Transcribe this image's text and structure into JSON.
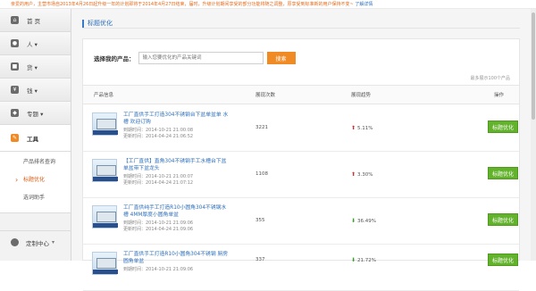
{
  "notice": {
    "text": "亲爱的用户，主营市场自2013年4月26日起升级一年的计划即将于2014年4月27日结束，届时，升级计划期间享受的部分功能将随之调整，原享受到标准新的用户保持不变~",
    "link": "了解详情"
  },
  "sidebar": {
    "items": [
      {
        "label": "首 页",
        "icon": "home-icon",
        "glyph": "⌂"
      },
      {
        "label": "人 ▾",
        "icon": "user-icon",
        "glyph": "●"
      },
      {
        "label": "货 ▾",
        "icon": "goods-icon",
        "glyph": "■"
      },
      {
        "label": "钱 ▾",
        "icon": "money-icon",
        "glyph": "¥"
      },
      {
        "label": "专题 ▾",
        "icon": "topic-icon",
        "glyph": "◆"
      }
    ],
    "active": {
      "label": "工具",
      "icon": "wrench-icon",
      "glyph": "✎"
    },
    "sub_items": [
      "产品排名查询",
      "标题优化",
      "选词助手"
    ],
    "bottom": {
      "label": "定制中心",
      "arrow": "▾",
      "icon": "gear-icon"
    }
  },
  "panel": {
    "title": "标题优化"
  },
  "search": {
    "label": "选择我的产品：",
    "placeholder": "输入您要优化的产品关键词",
    "button": "搜索"
  },
  "limit_text": "最多展示100个产品",
  "table": {
    "headers": [
      "产品信息",
      "展现次数",
      "展现趋势",
      "操作"
    ],
    "rows": [
      {
        "title": "工厂直供手工打造304不锈钢台下盆单盆单 水槽 欢迎订购",
        "time1": "到期时间：2014-10-21 21:00:08",
        "time2": "更新时间：2014-04-24 21:06:52",
        "views": "3221",
        "direction": "up",
        "trend": "5.11%",
        "action": "标题优化"
      },
      {
        "title": "【工厂直供】直角304不锈钢手工水槽台下盆单盆带下盆龙头",
        "time1": "到期时间：2014-10-21 21:00:07",
        "time2": "更新时间：2014-04-24 21:07:12",
        "views": "1108",
        "direction": "up",
        "trend": "3.30%",
        "action": "标题优化"
      },
      {
        "title": "工厂直供纯手工打造R10小圆角304不锈钢水槽 4MM厚度小圆角单盆",
        "time1": "到期时间：2014-10-21 21:09:06",
        "time2": "更新时间：2014-04-24 21:09:06",
        "views": "355",
        "direction": "down",
        "trend": "36.49%",
        "action": "标题优化"
      },
      {
        "title": "工厂直供手工打造R10小圆角304不锈钢 厨房 圆角单盆",
        "time1": "到期时间：2014-10-21 21:09:06",
        "time2": "",
        "views": "337",
        "direction": "down",
        "trend": "21.72%",
        "action": "标题优化"
      }
    ]
  },
  "colors": {
    "accent": "#f08a24",
    "link": "#2a6ebb",
    "action": "#63b22c",
    "up": "#d62d2d",
    "down": "#36a024"
  }
}
